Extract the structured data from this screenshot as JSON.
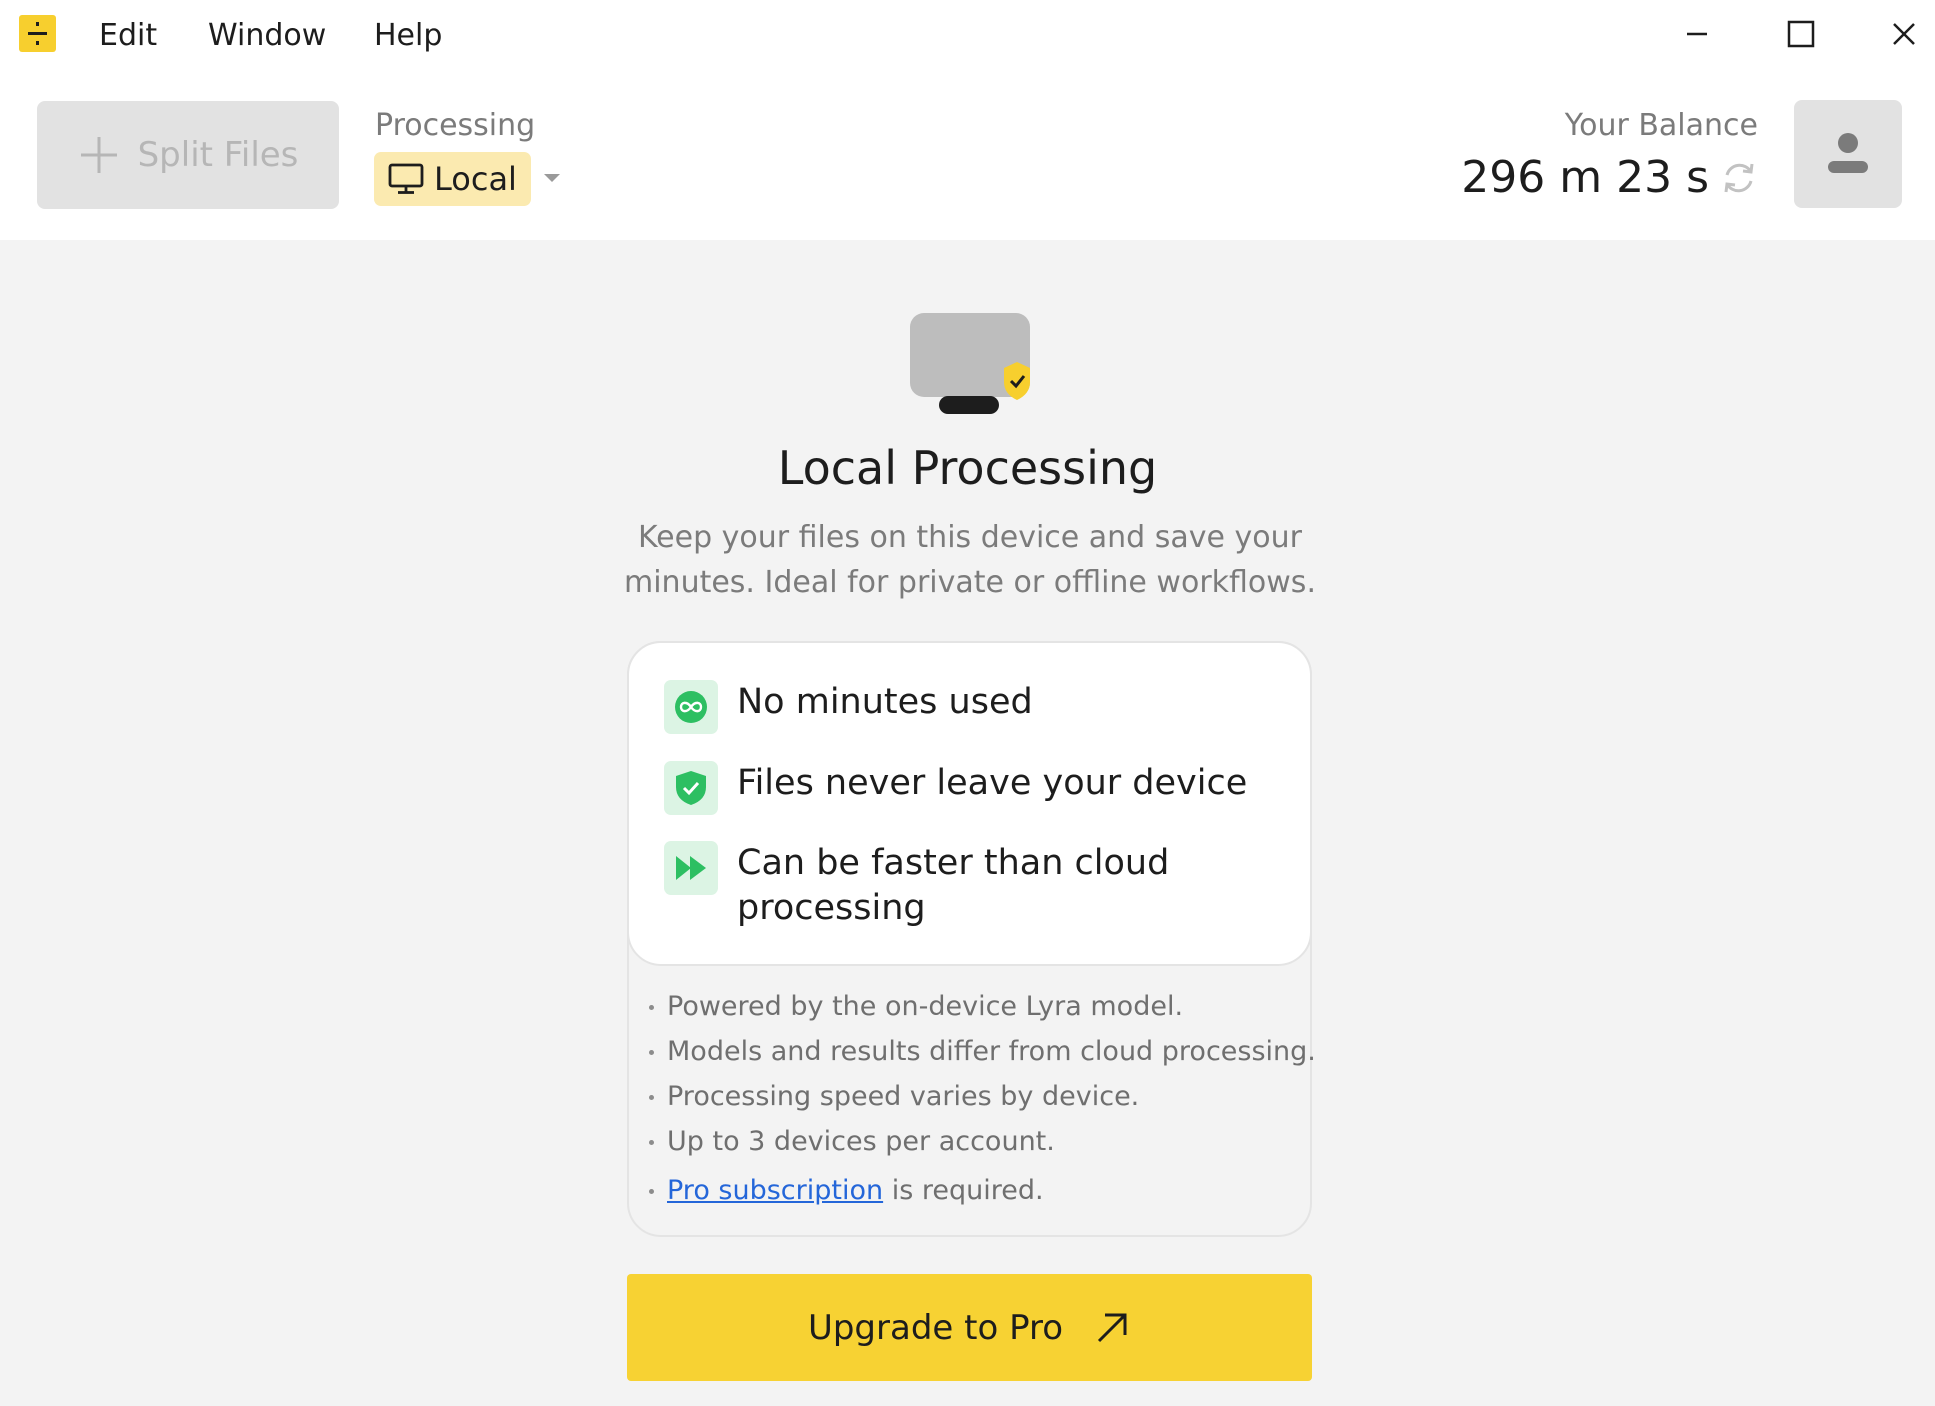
{
  "menubar": {
    "items": [
      "Edit",
      "Window",
      "Help"
    ]
  },
  "toolbar": {
    "split_files_label": "Split Files",
    "processing_label": "Processing",
    "processing_mode": "Local",
    "balance_label": "Your Balance",
    "balance_value": "296 m 23 s"
  },
  "panel": {
    "title": "Local Processing",
    "description": "Keep your files on this device and save your minutes. Ideal for private or offline workflows.",
    "features": [
      {
        "icon": "infinity-icon",
        "text": "No minutes used"
      },
      {
        "icon": "shield-check-icon",
        "text": "Files never leave your device"
      },
      {
        "icon": "fast-forward-icon",
        "text": "Can be faster than cloud processing"
      }
    ],
    "notes": [
      "Powered by the on-device Lyra model.",
      "Models and results differ from cloud processing.",
      "Processing speed varies by device.",
      "Up to 3 devices per account."
    ],
    "pro_link": "Pro subscription",
    "pro_suffix": " is required.",
    "upgrade_label": "Upgrade to Pro"
  },
  "colors": {
    "accent": "#f7d233",
    "chip_bg": "#fbeab0",
    "feature_green": "#2dbf62",
    "link": "#2466d9"
  }
}
